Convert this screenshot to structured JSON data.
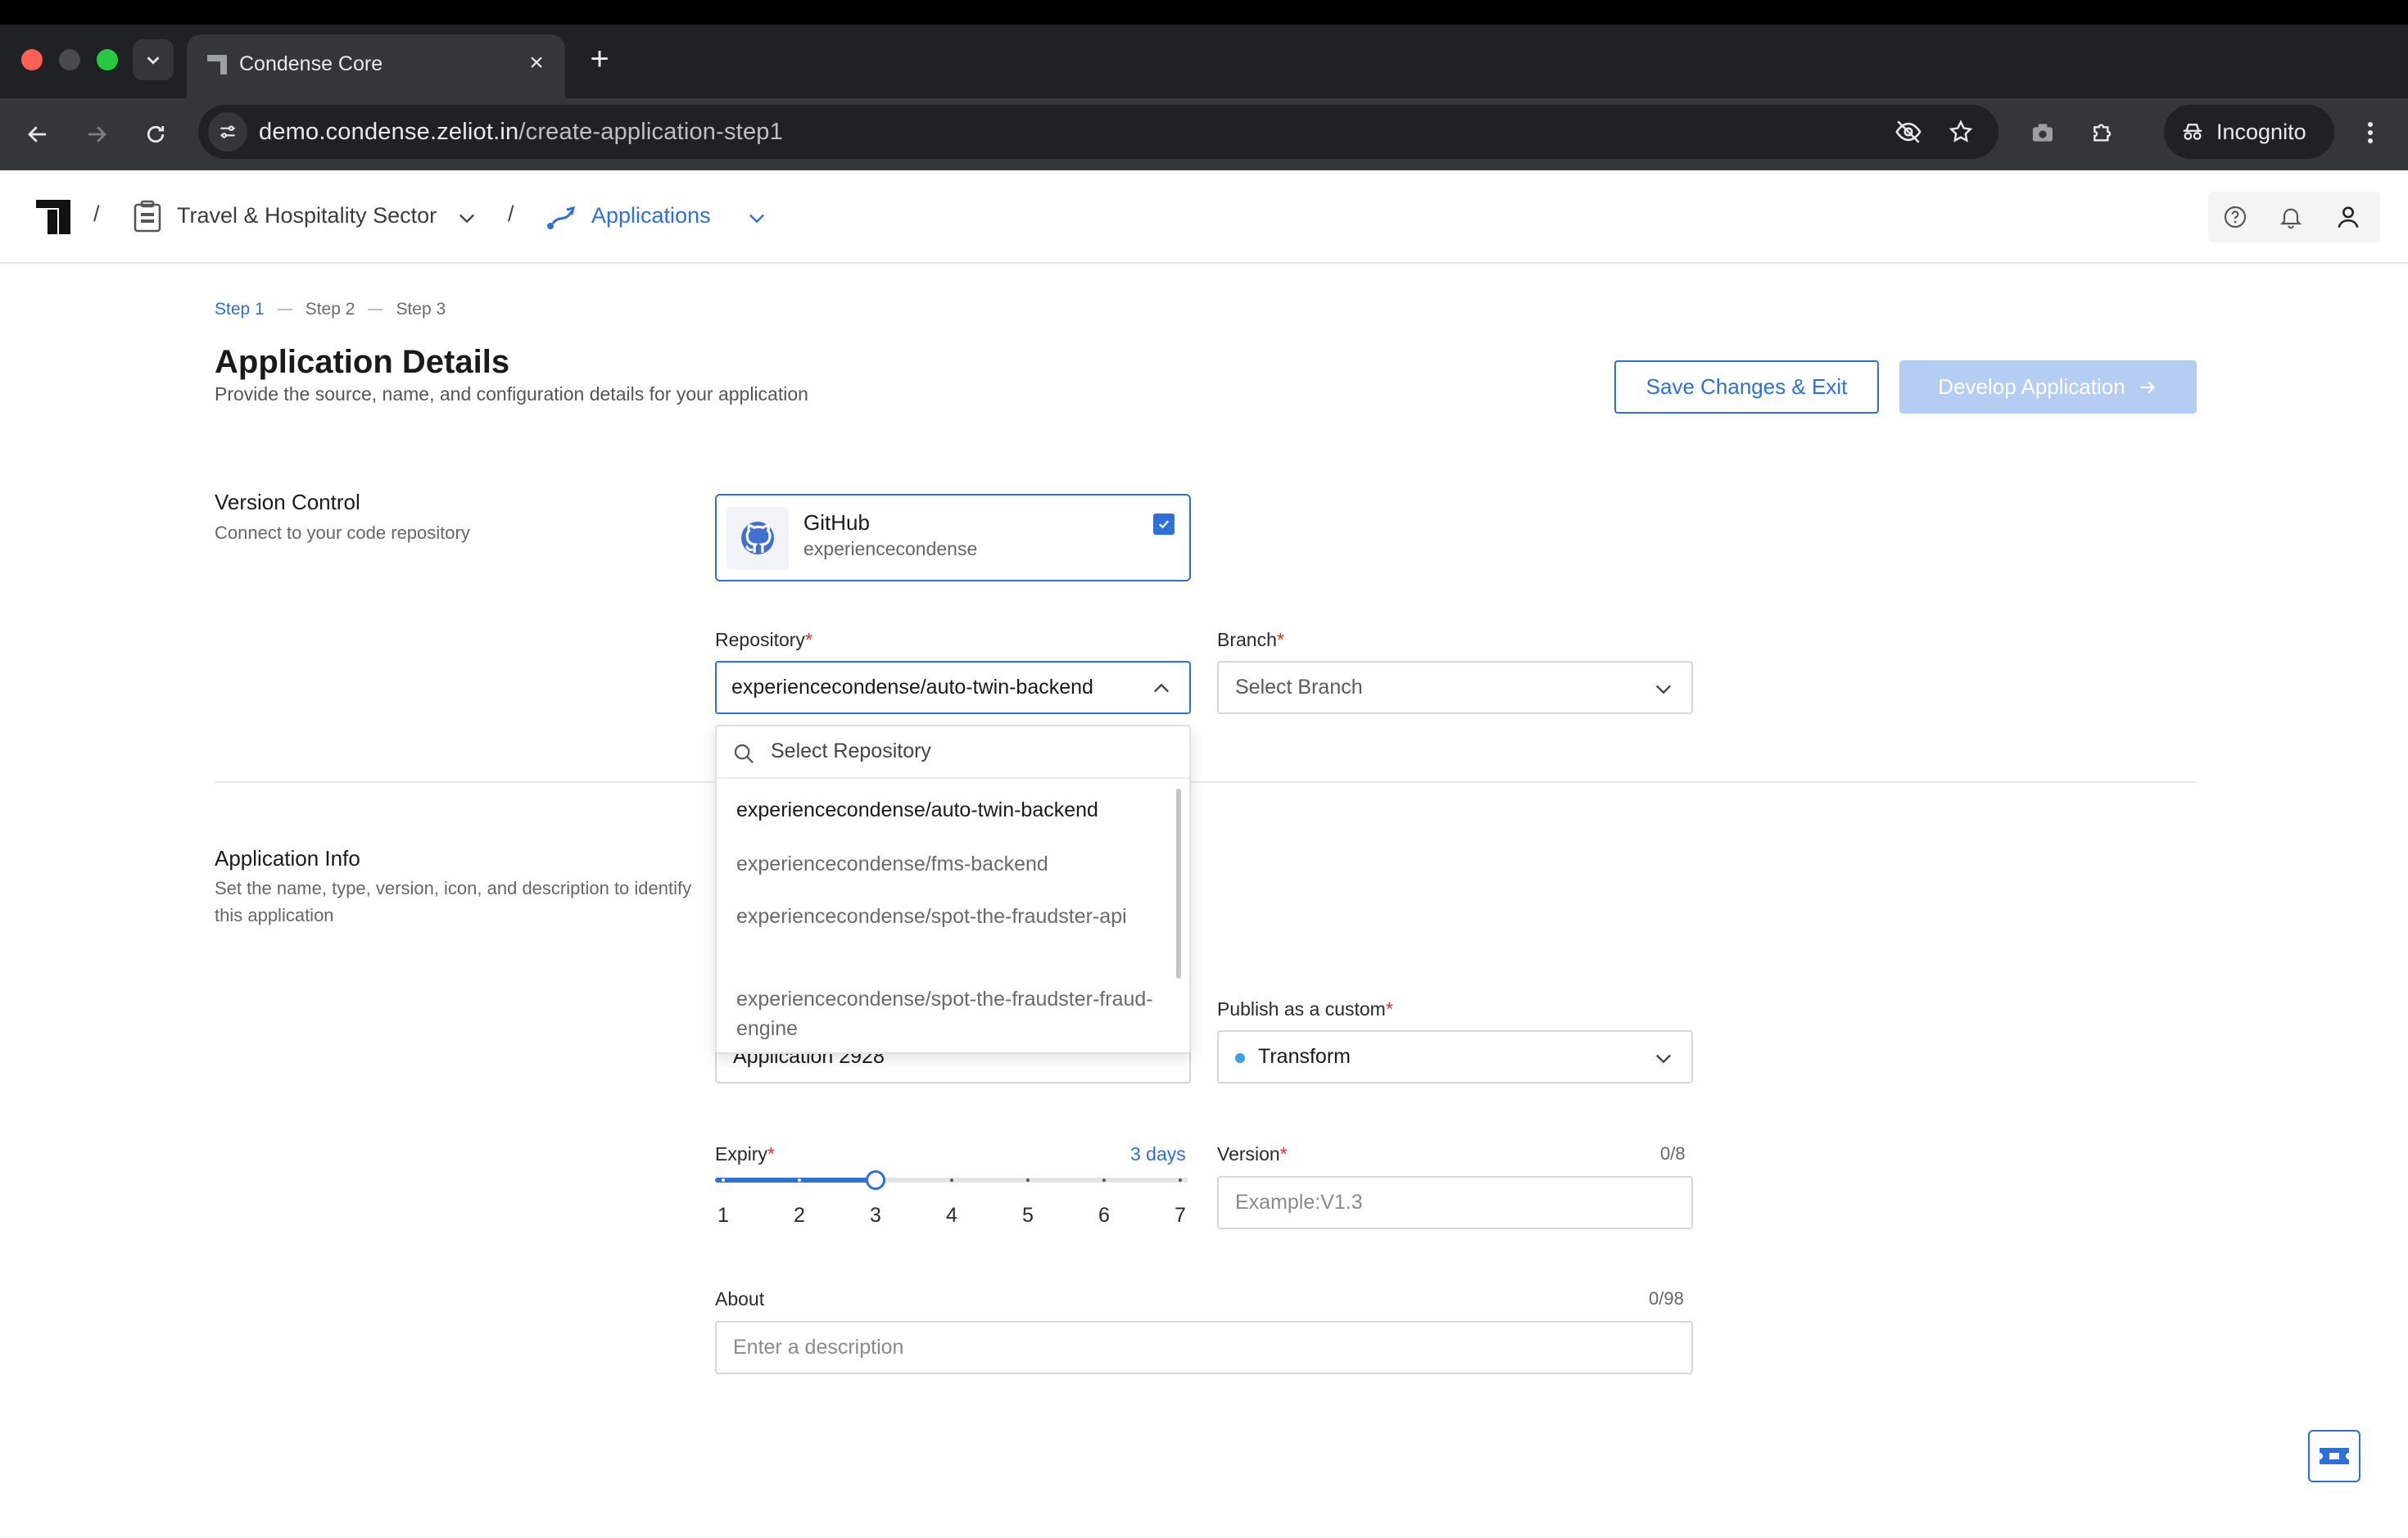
{
  "browser": {
    "tab_title": "Condense Core",
    "url_host": "demo.condense.zeliot.in",
    "url_path": "/create-application-step1",
    "incognito_label": "Incognito"
  },
  "header": {
    "org_name": "Travel & Hospitality Sector",
    "section_name": "Applications",
    "separator": "/"
  },
  "steps": [
    "Step 1",
    "Step 2",
    "Step 3"
  ],
  "page": {
    "title": "Application Details",
    "subtitle": "Provide the source, name, and configuration details for your application",
    "save_label": "Save Changes & Exit",
    "develop_label": "Develop Application"
  },
  "version_control": {
    "title": "Version Control",
    "desc": "Connect to your code repository",
    "provider": "GitHub",
    "account": "experiencecondense",
    "checked": true
  },
  "repository": {
    "label": "Repository",
    "value": "experiencecondense/auto-twin-backend",
    "search_placeholder": "Select Repository",
    "options": [
      "experiencecondense/auto-twin-backend",
      "experiencecondense/fms-backend",
      "experiencecondense/spot-the-fraudster-api",
      "experiencecondense/spot-the-fraudster-fraud-engine"
    ]
  },
  "branch": {
    "label": "Branch",
    "placeholder": "Select Branch"
  },
  "application_info": {
    "title": "Application Info",
    "desc": "Set the name, type, version, icon, and description to identify this application",
    "name_value": "Application 2928",
    "publish_label": "Publish as a custom",
    "publish_value": "Transform"
  },
  "expiry": {
    "label": "Expiry",
    "value_text": "3 days",
    "value": 3,
    "ticks": [
      "1",
      "2",
      "3",
      "4",
      "5",
      "6",
      "7"
    ]
  },
  "version": {
    "label": "Version",
    "counter": "0/8",
    "placeholder": "Example:V1.3"
  },
  "about": {
    "label": "About",
    "counter": "0/98",
    "placeholder": "Enter a description"
  },
  "required_marker": "*",
  "colors": {
    "accent": "#2f6fd8",
    "required": "#d93025",
    "transform_dot": "#3aa0e8"
  }
}
